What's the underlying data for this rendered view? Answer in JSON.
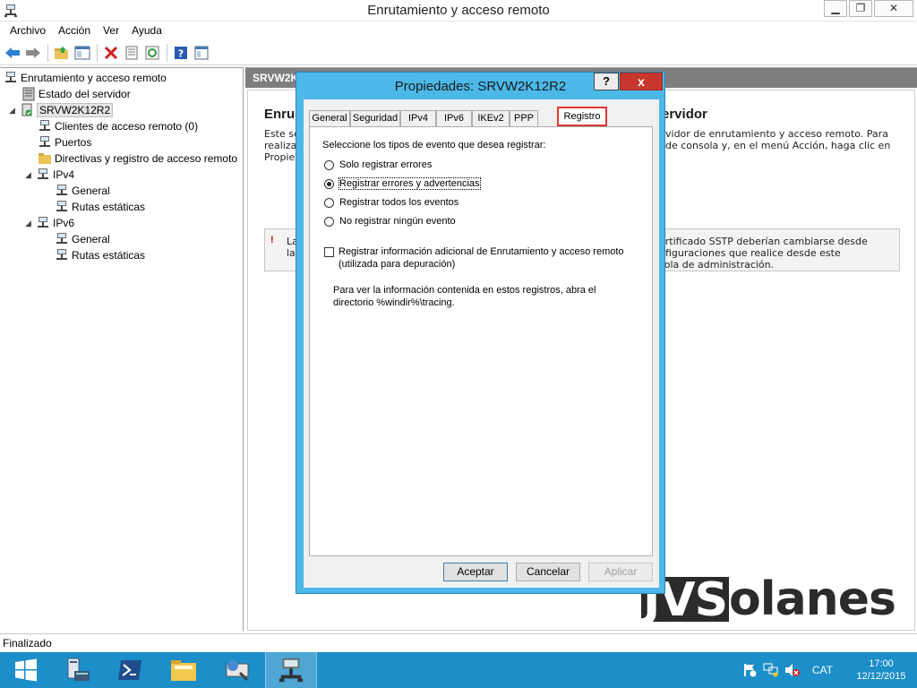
{
  "window": {
    "title": "Enrutamiento y acceso remoto",
    "minimize": "▁",
    "restore": "❐",
    "close": "✕"
  },
  "menu": [
    "Archivo",
    "Acción",
    "Ver",
    "Ayuda"
  ],
  "toolbar_icons": [
    "back-icon",
    "forward-icon",
    "up-folder-icon",
    "show-hide-tree-icon",
    "delete-icon",
    "properties-icon",
    "refresh-icon",
    "help-icon",
    "view-icon"
  ],
  "tree": {
    "root": "Enrutamiento y acceso remoto",
    "server_status": "Estado del servidor",
    "server": "SRVW2K12R2",
    "clients": "Clientes de acceso remoto (0)",
    "ports": "Puertos",
    "policies": "Directivas y registro de acceso remoto",
    "ipv4": "IPv4",
    "ipv4_general": "General",
    "ipv4_routes": "Rutas estáticas",
    "ipv6": "IPv6",
    "ipv6_general": "General",
    "ipv6_routes": "Rutas estáticas",
    "expander": "◢"
  },
  "right_pane": {
    "header": "SRVW2K",
    "heading_left": "Enru",
    "heading_right": "ervidor",
    "text_left": [
      "Este se",
      "realiza",
      "Propie"
    ],
    "text_right": [
      "vidor de enrutamiento y acceso remoto. Para",
      "de consola y, en el menú Acción, haga clic en"
    ],
    "warning_icon": "!",
    "warning_left": [
      "La",
      "la"
    ],
    "warning_right": [
      "ertificado SSTP deberían cambiarse desde",
      "nfiguraciones que realice desde este",
      "sola de administración."
    ]
  },
  "status_bar": "Finalizado",
  "watermark": {
    "boxed": "JVS",
    "rest": "olanes"
  },
  "dialog": {
    "title": "Propiedades: SRVW2K12R2",
    "help": "?",
    "close": "x",
    "tabs": [
      "General",
      "Seguridad",
      "IPv4",
      "IPv6",
      "IKEv2",
      "PPP",
      "Registro"
    ],
    "active_tab": "Registro",
    "prompt": "Seleccione los tipos de evento que desea registrar:",
    "options": [
      {
        "label": "Solo registrar errores",
        "selected": false
      },
      {
        "label": "Registrar errores y advertencias",
        "selected": true
      },
      {
        "label": "Registrar todos los eventos",
        "selected": false
      },
      {
        "label": "No registrar ningún evento",
        "selected": false
      }
    ],
    "checkbox_label_1": "Registrar información adicional de Enrutamiento y acceso remoto",
    "checkbox_label_2": "(utilizada para depuración)",
    "checkbox_checked": false,
    "info_1": "Para ver la información contenida en estos registros, abra el",
    "info_2": "directorio %windir%\\tracing.",
    "buttons": {
      "ok": "Aceptar",
      "cancel": "Cancelar",
      "apply": "Aplicar"
    }
  },
  "taskbar": {
    "items": [
      "start-button",
      "server-manager",
      "powershell",
      "file-explorer",
      "network-settings",
      "routing-remote-access"
    ],
    "lang": "CAT",
    "time": "17:00",
    "date": "12/12/2015"
  },
  "colors": {
    "dialog_frame": "#4cb8e8",
    "active_tab_border": "#e03a2e",
    "taskbar": "#1c8ec8",
    "close_button": "#c7372d"
  }
}
